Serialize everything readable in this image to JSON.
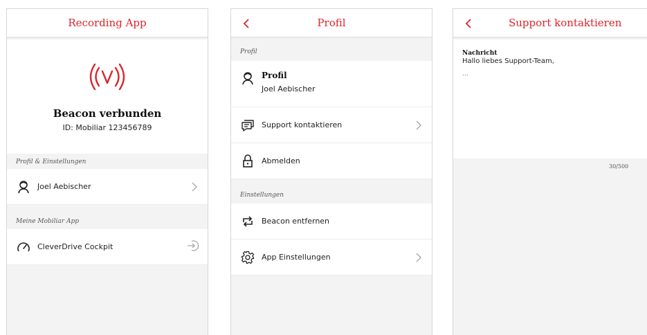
{
  "screen1": {
    "title": "Recording App",
    "status_title": "Beacon verbunden",
    "status_id": "ID: Mobiliar 123456789",
    "section_profile": "Profil & Einstellungen",
    "profile_name": "Joel Aebischer",
    "section_app": "Meine Mobiliar App",
    "cockpit_label": "CleverDrive Cockpit"
  },
  "screen2": {
    "title": "Profil",
    "section_profile": "Profil",
    "profile_heading": "Profil",
    "profile_name": "Joel Aebischer",
    "support_label": "Support kontaktieren",
    "logout_label": "Abmelden",
    "section_settings": "Einstellungen",
    "beacon_remove_label": "Beacon entfernen",
    "app_settings_label": "App Einstellungen"
  },
  "screen3": {
    "title": "Support kontaktieren",
    "message_label": "Nachricht",
    "message_line1": "Hallo liebes Support-Team,",
    "message_line2": "...",
    "char_count": "30/500"
  },
  "colors": {
    "accent": "#d9262b",
    "background": "#f3f3f3",
    "surface": "#ffffff",
    "divider": "#ececec"
  }
}
